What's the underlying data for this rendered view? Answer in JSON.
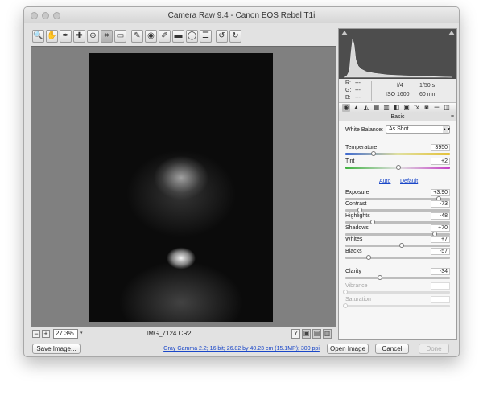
{
  "window": {
    "title": "Camera Raw 9.4  -  Canon EOS Rebel T1i"
  },
  "toolbar": {
    "tools": [
      {
        "name": "zoom-tool",
        "glyph": "🔍"
      },
      {
        "name": "hand-tool",
        "glyph": "✋"
      },
      {
        "name": "white-balance-tool",
        "glyph": "✒"
      },
      {
        "name": "color-sampler-tool",
        "glyph": "✚"
      },
      {
        "name": "targeted-adjustment-tool",
        "glyph": "⊕"
      },
      {
        "name": "crop-tool",
        "glyph": "⌗"
      },
      {
        "name": "straighten-tool",
        "glyph": "▭"
      },
      {
        "name": "spot-removal-tool",
        "glyph": "✎"
      },
      {
        "name": "red-eye-tool",
        "glyph": "◉"
      },
      {
        "name": "adjustment-brush-tool",
        "glyph": "✐"
      },
      {
        "name": "graduated-filter-tool",
        "glyph": "▬"
      },
      {
        "name": "radial-filter-tool",
        "glyph": "◯"
      },
      {
        "name": "preferences-tool",
        "glyph": "☰"
      },
      {
        "name": "rotate-left-tool",
        "glyph": "↺"
      },
      {
        "name": "rotate-right-tool",
        "glyph": "↻"
      }
    ],
    "export_glyph": "⇲"
  },
  "preview": {
    "zoom": "27.3%",
    "filename": "IMG_7124.CR2",
    "zoom_minus": "−",
    "zoom_plus": "+",
    "zoom_arrow": "▾",
    "view_buttons": [
      "Y",
      "▣",
      "▤",
      "▥"
    ]
  },
  "readout": {
    "r_label": "R:",
    "r_value": "---",
    "g_label": "G:",
    "g_value": "---",
    "b_label": "B:",
    "b_value": "---",
    "aperture": "f/4",
    "shutter": "1/50 s",
    "iso": "ISO 1600",
    "focal": "60 mm"
  },
  "panel": {
    "title": "Basic",
    "menu_glyph": "≡",
    "tabs": [
      "◉",
      "▲",
      "◭",
      "▦",
      "▥",
      "◧",
      "▣",
      "fx",
      "◙",
      "☰",
      "◫"
    ],
    "white_balance_label": "White Balance:",
    "white_balance_value": "As Shot",
    "auto_link": "Auto",
    "default_link": "Default",
    "sliders": [
      {
        "label": "Temperature",
        "value": "3950",
        "level": 0.27,
        "track": "temp",
        "disabled": false
      },
      {
        "label": "Tint",
        "value": "+2",
        "level": 0.51,
        "track": "tint",
        "disabled": false
      },
      {
        "label": "Exposure",
        "value": "+3.90",
        "level": 0.89,
        "track": "plain",
        "disabled": false
      },
      {
        "label": "Contrast",
        "value": "-73",
        "level": 0.14,
        "track": "plain",
        "disabled": false
      },
      {
        "label": "Highlights",
        "value": "-48",
        "level": 0.26,
        "track": "plain",
        "disabled": false
      },
      {
        "label": "Shadows",
        "value": "+70",
        "level": 0.85,
        "track": "plain",
        "disabled": false
      },
      {
        "label": "Whites",
        "value": "+7",
        "level": 0.54,
        "track": "plain",
        "disabled": false
      },
      {
        "label": "Blacks",
        "value": "-57",
        "level": 0.22,
        "track": "plain",
        "disabled": false
      },
      {
        "label": "Clarity",
        "value": "-34",
        "level": 0.33,
        "track": "plain",
        "disabled": false
      },
      {
        "label": "Vibrance",
        "value": "",
        "level": 0.0,
        "track": "plain",
        "disabled": true
      },
      {
        "label": "Saturation",
        "value": "",
        "level": 0.0,
        "track": "plain",
        "disabled": true
      }
    ]
  },
  "footer": {
    "save_image": "Save Image...",
    "workflow": "Gray Gamma 2.2; 16 bit; 26.82 by 40.23 cm (15.1MP); 300 ppi",
    "open_image": "Open Image",
    "cancel": "Cancel",
    "done": "Done"
  },
  "colors": {
    "accent_link": "#1a47c8",
    "panel_bg": "#f6f6f6",
    "preview_bg": "#808080"
  }
}
